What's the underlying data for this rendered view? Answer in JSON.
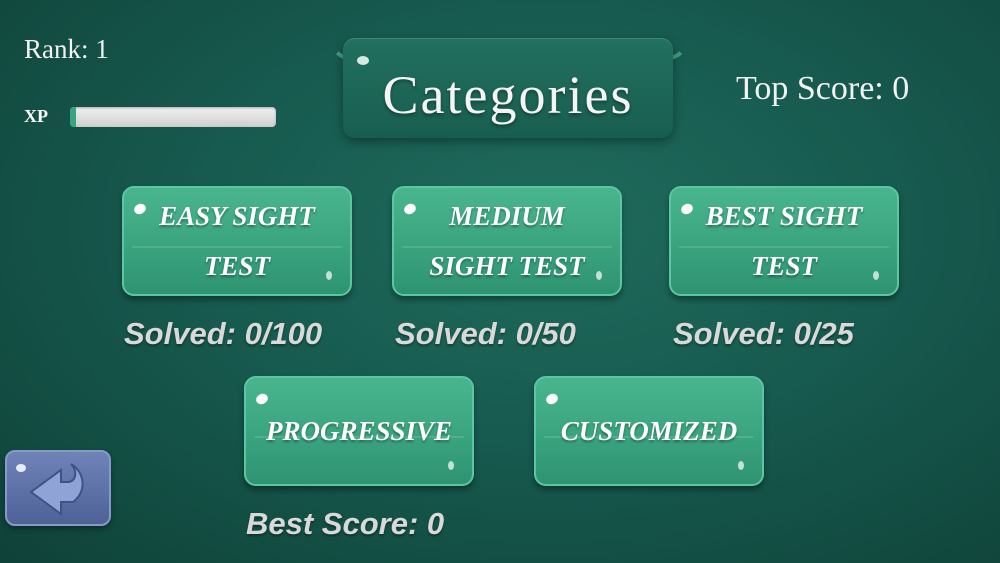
{
  "hud": {
    "rank": "Rank: 1",
    "xp_label": "XP",
    "xp_progress": 0.03,
    "top_score": "Top Score: 0"
  },
  "title": "Categories",
  "categories": [
    {
      "label": "EASY SIGHT TEST",
      "line1": "EASY SIGHT",
      "line2": "TEST",
      "stat": "Solved: 0/100"
    },
    {
      "label": "MEDIUM SIGHT TEST",
      "line1": "MEDIUM",
      "line2": "SIGHT TEST",
      "stat": "Solved: 0/50"
    },
    {
      "label": "BEST SIGHT TEST",
      "line1": "BEST SIGHT",
      "line2": "TEST",
      "stat": "Solved: 0/25"
    },
    {
      "label": "PROGRESSIVE",
      "line1": "PROGRESSIVE",
      "stat": "Best Score: 0"
    },
    {
      "label": "CUSTOMIZED",
      "line1": "CUSTOMIZED"
    }
  ],
  "icons": {
    "back": "back-arrow-icon"
  },
  "colors": {
    "background": "#175a4f",
    "button": "#3aa47f",
    "back_button": "#5a6ea5"
  }
}
